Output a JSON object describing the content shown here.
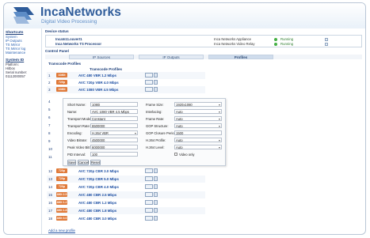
{
  "brand": {
    "name": "IncaNetworks",
    "subtitle": "Digital Video Processing"
  },
  "colors": {
    "accent": "#2f5c9a",
    "badge": "#e07a3a",
    "status_ok": "#45b045"
  },
  "sidebar": {
    "sections": [
      {
        "title": "Shortcuts",
        "items": [
          "System",
          "IP Outputs",
          "TS Mirror",
          "TS Mirror log",
          "Maintenance"
        ]
      },
      {
        "title": "System ID",
        "lines": [
          "Platform:",
          "Hitbox",
          "Serial number:",
          "01112000057"
        ]
      }
    ]
  },
  "device_status": {
    "title": "Device status",
    "rows": [
      {
        "name": "IncaIn11.ouvert1",
        "type": "Inca Networks Appliance",
        "status": "Running"
      },
      {
        "name": "Inca Networks TS Processor",
        "type": "Inca Networks Video Relay",
        "status": "Running"
      }
    ]
  },
  "control_panel": {
    "title": "Control Panel"
  },
  "tabs": [
    {
      "label": "IP Sources",
      "active": false
    },
    {
      "label": "IP Outputs",
      "active": false
    },
    {
      "label": "Profiles",
      "active": true
    }
  ],
  "transcode_profiles": {
    "title": "Transcode Profiles",
    "column_header": "Transcode Profiles",
    "rows_top": [
      {
        "num": "1",
        "badge": "1080i",
        "name": "AVC 480 VBR 1.2 Mbps"
      },
      {
        "num": "2",
        "badge": "720p",
        "name": "AVC 720p VBR 4.0 Mbps"
      },
      {
        "num": "3",
        "badge": "1080i",
        "name": "AVC 1080 VBR 4.5 Mbps"
      }
    ],
    "rows_left_numbers": [
      "4",
      "5",
      "6",
      "7",
      "8",
      "9",
      "10",
      "11"
    ],
    "rows_bottom": [
      {
        "num": "12",
        "badge": "720p 3.0",
        "name": "AVC 720p CBR 3.0 Mbps"
      },
      {
        "num": "13",
        "badge": "720p 4.0",
        "name": "AVC 720p CBR 5.0 Mbps"
      },
      {
        "num": "14",
        "badge": "720p 4.0",
        "name": "AVC 720p CBR 4.0 Mbps"
      },
      {
        "num": "15",
        "badge": "480i 2.5",
        "name": "AVC 480 CBR 2.5 Mbps"
      },
      {
        "num": "16",
        "badge": "480i 1.2",
        "name": "AVC 480 CBR 1.2 Mbps"
      },
      {
        "num": "17",
        "badge": "480i 1.8",
        "name": "AVC 480 CBR 1.8 Mbps"
      },
      {
        "num": "18",
        "badge": "480i 3.0",
        "name": "AVC 480 CBR 3.0 Mbps"
      }
    ],
    "add_link": "Add a new profile"
  },
  "editor": {
    "left_fields": [
      {
        "label": "Short Name:",
        "value": "1080i",
        "kind": "input"
      },
      {
        "label": "Name:",
        "value": "AVC 1080 VBR 4.5 Mbps",
        "kind": "input"
      },
      {
        "label": "Transport Mode:",
        "value": "Constant",
        "kind": "input"
      },
      {
        "label": "Transport Rate:",
        "value": "6500000",
        "kind": "input"
      },
      {
        "label": "Encoding:",
        "value": "H.264 VBR",
        "kind": "select"
      },
      {
        "label": "Video Bitrate:",
        "value": "4500000",
        "kind": "input"
      },
      {
        "label": "Peak Video Bitrate:",
        "value": "6000000",
        "kind": "input"
      },
      {
        "label": "PID Interval:",
        "value": "100",
        "kind": "input"
      }
    ],
    "right_fields": [
      {
        "label": "Frame Size:",
        "value": "1920x1080",
        "kind": "select"
      },
      {
        "label": "Interlacing:",
        "value": "Auto",
        "kind": "select"
      },
      {
        "label": "Frame Rate:",
        "value": "Auto",
        "kind": "select"
      },
      {
        "label": "GOP Structure:",
        "value": "Auto",
        "kind": "select"
      },
      {
        "label": "GOP Closure Period:",
        "value": "1500",
        "kind": "input"
      },
      {
        "label": "H.264 Profile:",
        "value": "Auto",
        "kind": "select"
      },
      {
        "label": "H.264 Level:",
        "value": "Auto",
        "kind": "select"
      }
    ],
    "video_only_label": "Video only",
    "buttons": {
      "save": "Save",
      "cancel": "Cancel",
      "reset": "Reset"
    }
  }
}
